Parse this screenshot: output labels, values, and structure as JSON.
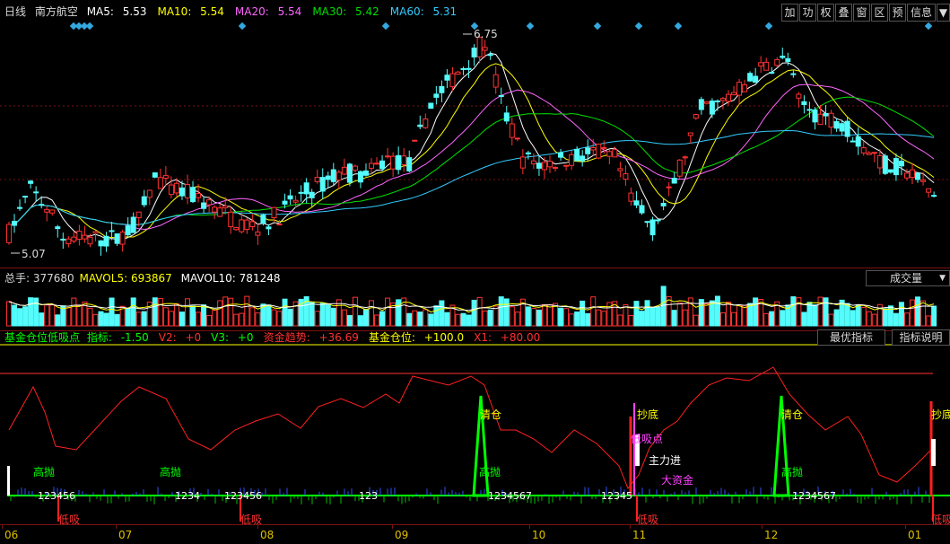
{
  "header": {
    "period": "日线",
    "stock_name": "南方航空",
    "ma": [
      {
        "label": "MA5:",
        "value": "5.53",
        "color": "#ffffff"
      },
      {
        "label": "MA10:",
        "value": "5.54",
        "color": "#ffff00"
      },
      {
        "label": "MA20:",
        "value": "5.54",
        "color": "#ff66ff"
      },
      {
        "label": "MA30:",
        "value": "5.42",
        "color": "#00e000"
      },
      {
        "label": "MA60:",
        "value": "5.31",
        "color": "#33ccff"
      }
    ],
    "high_marker": "6.75",
    "low_marker": "5.07"
  },
  "toolbar": {
    "buttons": [
      "加",
      "功",
      "权",
      "叠",
      "窗",
      "区",
      "预",
      "信息",
      "▼"
    ]
  },
  "volume": {
    "label": "总手:",
    "value": "377680",
    "mavol5_label": "MAVOL5:",
    "mavol5": "693867",
    "mavol10_label": "MAVOL10:",
    "mavol10": "781248",
    "selector": "成交量"
  },
  "indicator": {
    "name": "基金仓位低吸点",
    "items": [
      {
        "label": "指标:",
        "value": "-1.50",
        "color": "#00ff00"
      },
      {
        "label": "V2:",
        "value": "+0",
        "color": "#ff3030"
      },
      {
        "label": "V3:",
        "value": "+0",
        "color": "#00ff00"
      },
      {
        "label": "资金趋势:",
        "value": "+36.69",
        "color": "#ff3030"
      },
      {
        "label": "基金仓位:",
        "value": "+100.0",
        "color": "#ffff00"
      },
      {
        "label": "X1:",
        "value": "+80.00",
        "color": "#ff3030"
      }
    ],
    "btn_best": "最优指标",
    "btn_help": "指标说明",
    "signals": {
      "gaopao": "高抛",
      "dixi": "低吸",
      "qingcang": "清仓",
      "chaodi": "抄底",
      "dixidian": "低吸点",
      "zhulijin": "主力进",
      "dazijin": "大资金"
    },
    "numbers": [
      "123456",
      "1234",
      "123456",
      "123",
      "1234567",
      "12345",
      "1234567"
    ]
  },
  "x_axis": [
    "06",
    "07",
    "08",
    "09",
    "10",
    "11",
    "12",
    "01"
  ],
  "colors": {
    "up": "#ff3232",
    "down": "#54fcfc",
    "border": "#7a1212",
    "axis": "#e0c000"
  }
}
